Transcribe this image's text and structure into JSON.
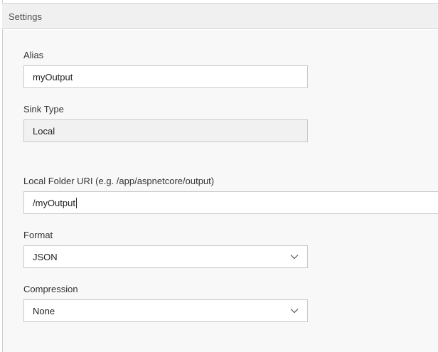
{
  "header": {
    "title": "Settings"
  },
  "alias": {
    "label": "Alias",
    "value": "myOutput"
  },
  "sink_type": {
    "label": "Sink Type",
    "value": "Local"
  },
  "local_folder": {
    "label": "Local Folder URI (e.g. /app/aspnetcore/output)",
    "value": "/myOutput"
  },
  "format": {
    "label": "Format",
    "selected": "JSON"
  },
  "compression": {
    "label": "Compression",
    "selected": "None"
  },
  "icons": {
    "dropdown": "chevron-down-icon"
  }
}
